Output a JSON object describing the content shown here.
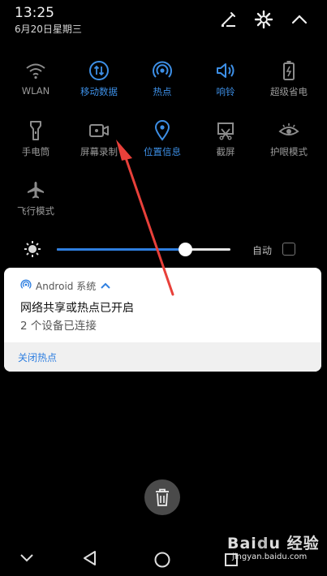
{
  "status": {
    "time": "13:25",
    "date": "6月20日星期三"
  },
  "header_icons": [
    "edit-icon",
    "settings-icon",
    "collapse-chevron-icon"
  ],
  "quick_settings": {
    "tiles": [
      {
        "name": "wlan",
        "label": "WLAN",
        "icon": "wifi-icon",
        "active": false
      },
      {
        "name": "mobile-data",
        "label": "移动数据",
        "icon": "mobile-data-icon",
        "active": true
      },
      {
        "name": "hotspot",
        "label": "热点",
        "icon": "hotspot-icon",
        "active": true
      },
      {
        "name": "ring",
        "label": "响铃",
        "icon": "speaker-icon",
        "active": true
      },
      {
        "name": "power-saver",
        "label": "超级省电",
        "icon": "battery-icon",
        "active": false
      },
      {
        "name": "flashlight",
        "label": "手电筒",
        "icon": "flashlight-icon",
        "active": false
      },
      {
        "name": "screen-record",
        "label": "屏幕录制",
        "icon": "video-record-icon",
        "active": false
      },
      {
        "name": "location",
        "label": "位置信息",
        "icon": "location-pin-icon",
        "active": true
      },
      {
        "name": "screenshot",
        "label": "截屏",
        "icon": "screenshot-icon",
        "active": false
      },
      {
        "name": "eye-comfort",
        "label": "护眼模式",
        "icon": "eye-icon",
        "active": false
      },
      {
        "name": "airplane",
        "label": "飞行模式",
        "icon": "airplane-icon",
        "active": false
      }
    ]
  },
  "brightness": {
    "level": 0.74,
    "auto_label": "自动",
    "auto_checked": false
  },
  "notification": {
    "app_name": "Android 系统",
    "title": "网络共享或热点已开启",
    "text": "2 个设备已连接",
    "action": "关闭热点"
  },
  "colors": {
    "accent": "#2f7fe0",
    "active_label": "#3d8fe6",
    "arrow": "#e8403a"
  },
  "watermark": {
    "brand": "Baidu经验",
    "url": "jingyan.baidu.com"
  }
}
